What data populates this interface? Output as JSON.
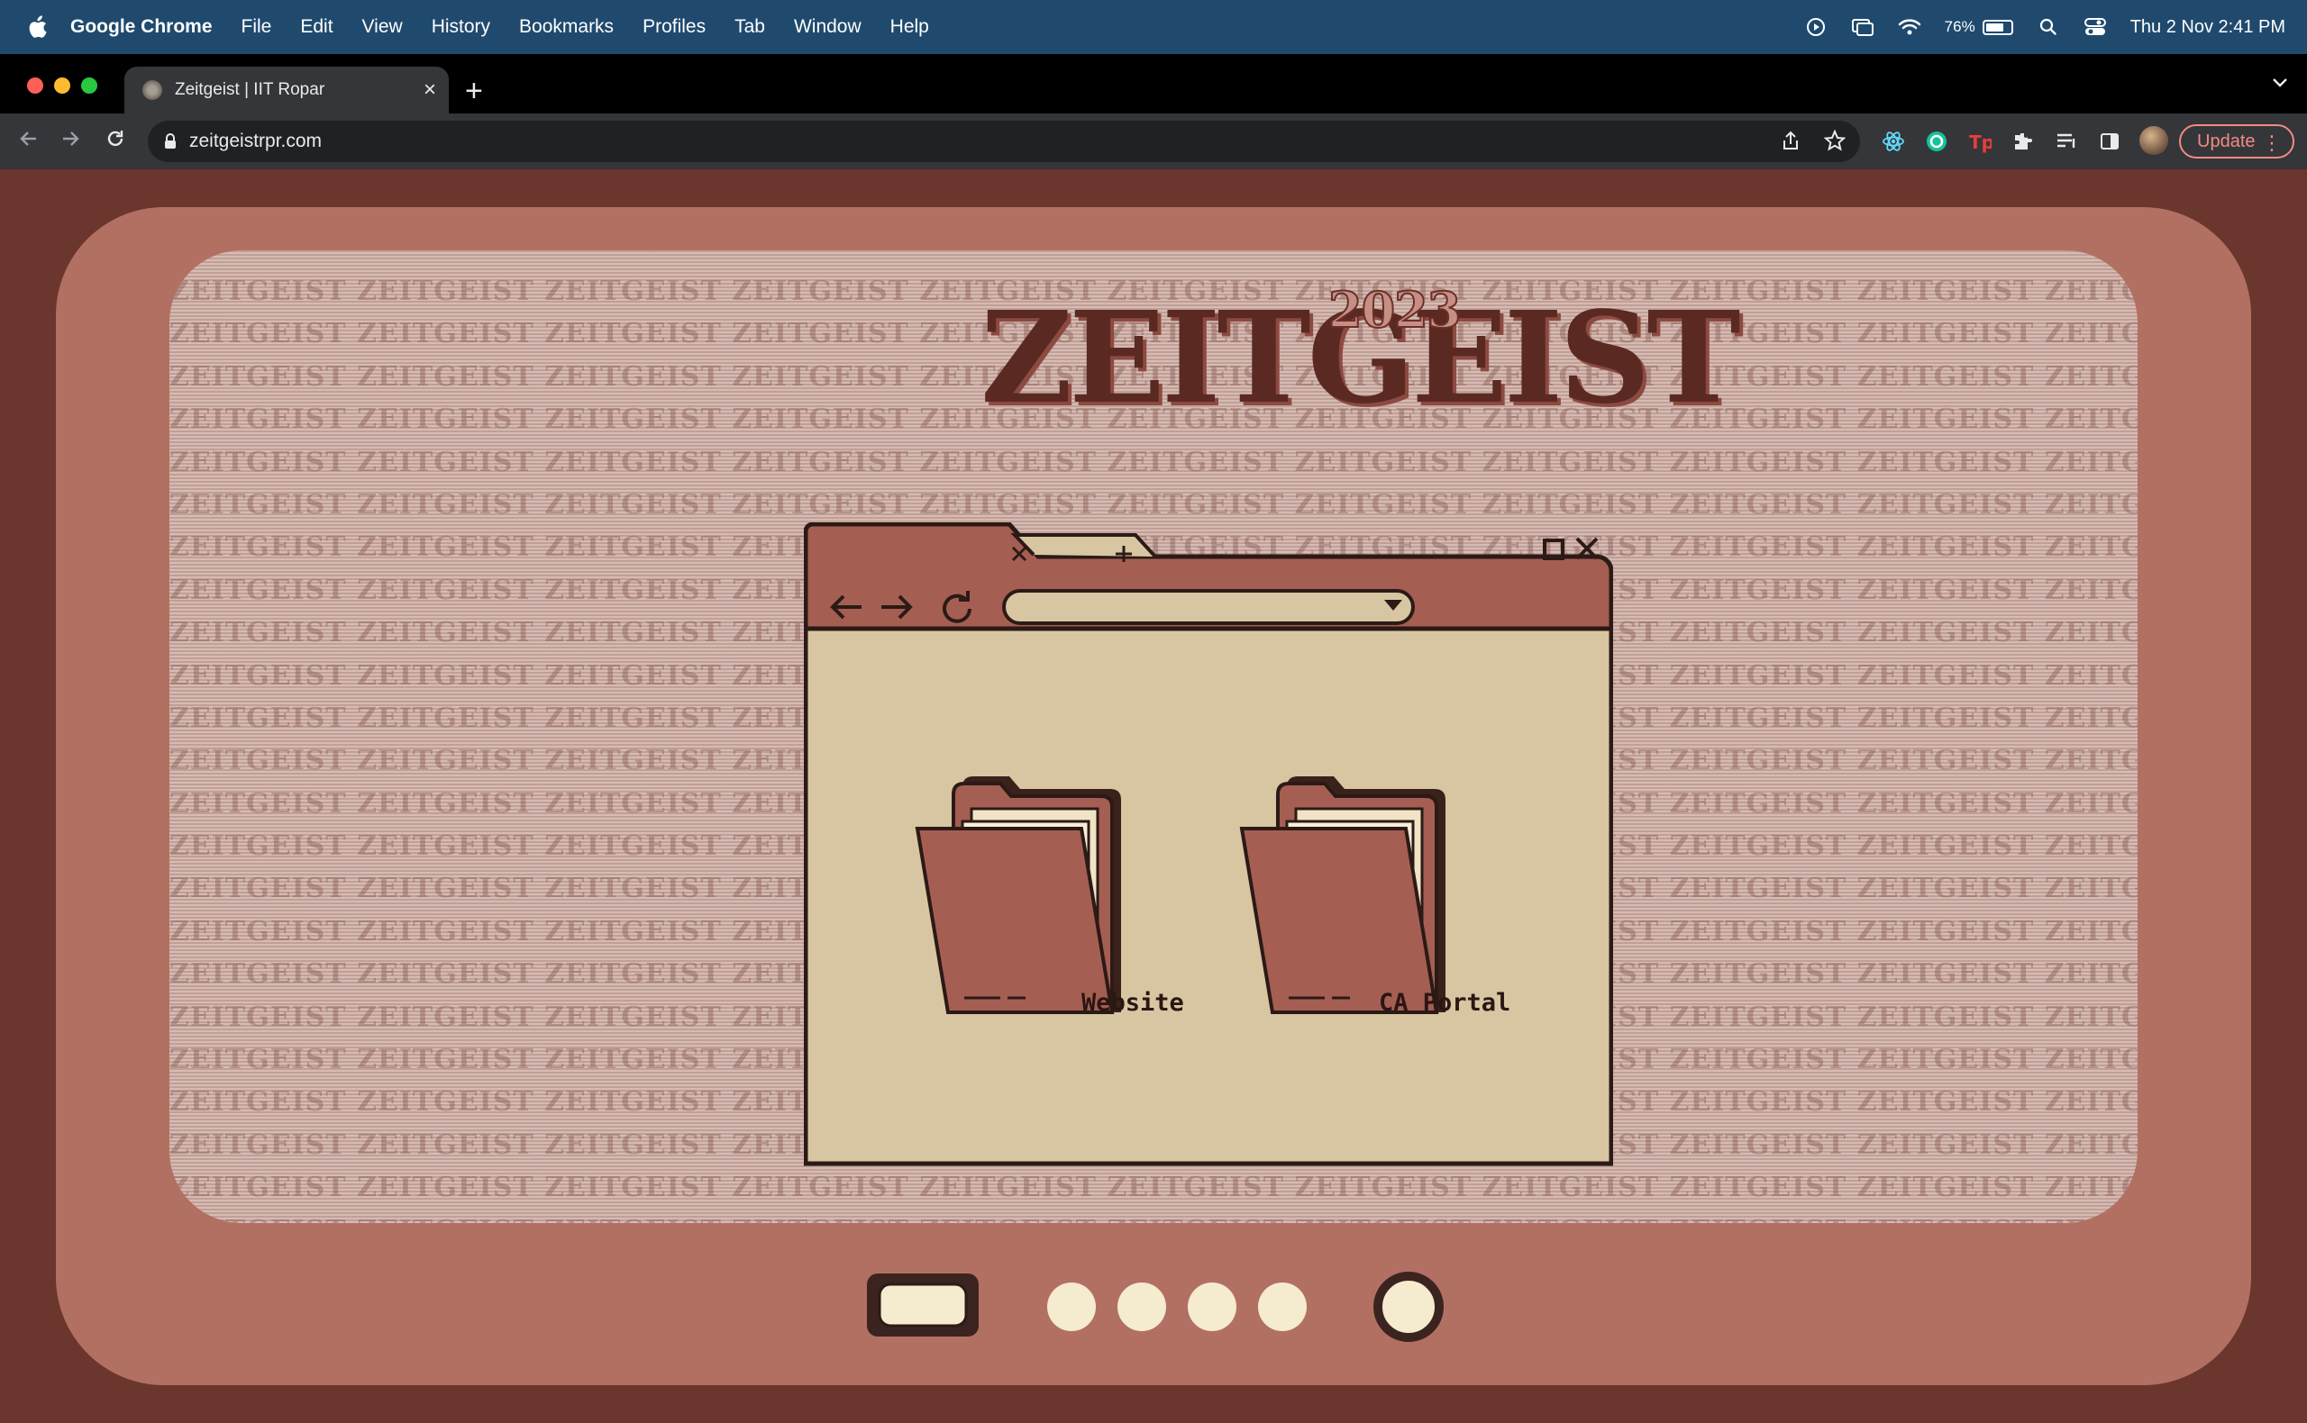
{
  "menubar": {
    "app_name": "Google Chrome",
    "items": [
      "File",
      "Edit",
      "View",
      "History",
      "Bookmarks",
      "Profiles",
      "Tab",
      "Window",
      "Help"
    ],
    "battery_percent": "76%",
    "battery_level": 0.76,
    "datetime": "Thu 2 Nov  2:41 PM",
    "status_icons": [
      "screen-record-icon",
      "screen-mirror-icon",
      "wifi-icon",
      "battery-icon",
      "spotlight-search-icon",
      "control-center-icon"
    ]
  },
  "browser": {
    "tab_title": "Zeitgeist | IIT Ropar",
    "url": "zeitgeistrpr.com",
    "update_label": "Update",
    "extensions": [
      "react-devtools-icon",
      "grammarly-icon",
      "tp-extension-icon",
      "extensions-puzzle-icon",
      "reading-list-icon",
      "side-panel-icon"
    ]
  },
  "page": {
    "logo_word": "ZEITGEIST",
    "logo_year": "2023",
    "pattern_word": "ZEITGEIST",
    "folders": [
      {
        "label": "Website"
      },
      {
        "label": "CA Portal"
      }
    ],
    "colors": {
      "background": "#6b362d",
      "tv_body": "#b27062",
      "screen": "#c9a9a0",
      "window_chrome": "#a45f52",
      "window_body": "#d8c6a2",
      "cream": "#f5ebcf",
      "dark": "#2b1a16"
    }
  }
}
